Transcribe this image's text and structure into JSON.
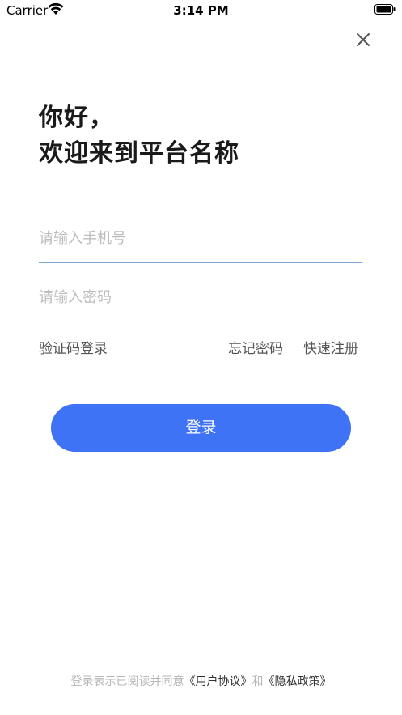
{
  "status_bar": {
    "carrier": "Carrier",
    "time": "3:14 PM",
    "icons": [
      "wifi-icon",
      "battery-icon"
    ]
  },
  "header": {
    "close_icon": "close-icon"
  },
  "greeting": {
    "line1": "你好，",
    "line2": "欢迎来到平台名称"
  },
  "form": {
    "phone_placeholder": "请输入手机号",
    "phone_value": "",
    "password_placeholder": "请输入密码",
    "password_value": ""
  },
  "links": {
    "sms_login": "验证码登录",
    "forgot_password": "忘记密码",
    "quick_register": "快速注册"
  },
  "login_button": {
    "label": "登录",
    "color": "#3f73f6"
  },
  "agreement": {
    "prefix": "登录表示已阅读并同意",
    "user_agreement": "《用户协议》",
    "connector": "和",
    "privacy_policy": "《隐私政策》"
  }
}
